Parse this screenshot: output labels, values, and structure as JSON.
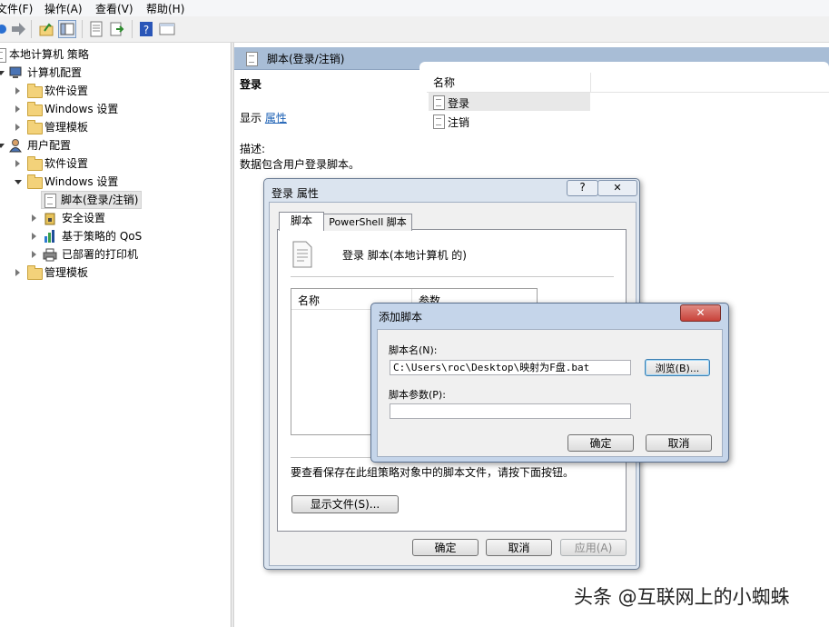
{
  "menu": [
    "文件(F)",
    "操作(A)",
    "查看(V)",
    "帮助(H)"
  ],
  "tree": {
    "root": "本地计算机 策略",
    "computer_config": "计算机配置",
    "cc_software": "软件设置",
    "cc_windows": "Windows 设置",
    "cc_admin": "管理模板",
    "user_config": "用户配置",
    "uc_software": "软件设置",
    "uc_windows": "Windows 设置",
    "uc_scripts": "脚本(登录/注销)",
    "uc_security": "安全设置",
    "uc_qos": "基于策略的 QoS",
    "uc_printers": "已部署的打印机",
    "uc_admin": "管理模板"
  },
  "right": {
    "header": "脚本(登录/注销)",
    "section_title": "登录",
    "show_label": "显示",
    "properties_link": "属性",
    "desc_label": "描述:",
    "desc_text": "数据包含用户登录脚本。",
    "column_name": "名称",
    "items": [
      "登录",
      "注销"
    ]
  },
  "props_dialog": {
    "title": "登录 属性",
    "tab_script": "脚本",
    "tab_powershell": "PowerShell 脚本",
    "heading": "登录 脚本(本地计算机 的)",
    "col_name": "名称",
    "col_params": "参数",
    "hint": "要查看保存在此组策略对象中的脚本文件，请按下面按钮。",
    "show_files": "显示文件(S)...",
    "ok": "确定",
    "cancel": "取消",
    "apply": "应用(A)",
    "help_glyph": "?",
    "close_glyph": "✕"
  },
  "add_dialog": {
    "title": "添加脚本",
    "name_label": "脚本名(N):",
    "name_value": "C:\\Users\\roc\\Desktop\\映射为F盘.bat",
    "browse": "浏览(B)...",
    "params_label": "脚本参数(P):",
    "params_value": "",
    "ok": "确定",
    "cancel": "取消",
    "close_glyph": "✕"
  },
  "watermark": "头条 @互联网上的小蜘蛛",
  "colors": {
    "link": "#1a5fb4",
    "title_bar": "#a8bdd6",
    "close_red": "#c8423a"
  }
}
